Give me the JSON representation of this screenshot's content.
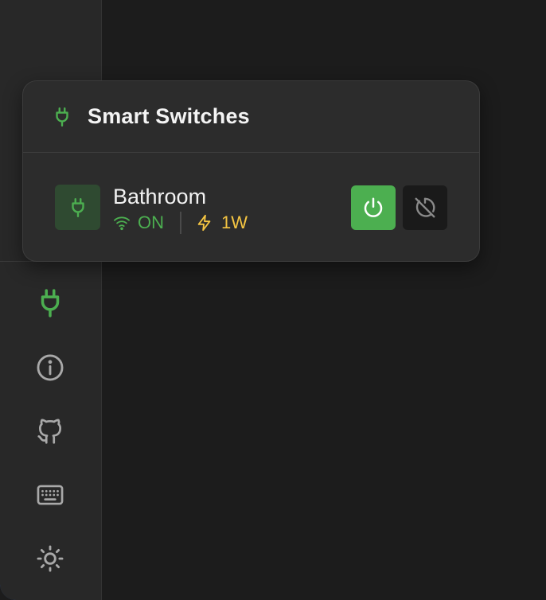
{
  "panel": {
    "title": "Smart Switches",
    "title_icon": "plug-icon"
  },
  "switches": [
    {
      "name": "Bathroom",
      "state": "ON",
      "power": "1W",
      "icons": {
        "device": "plug-icon",
        "signal": "wifi-icon",
        "power": "bolt-icon",
        "toggle": "power-icon",
        "timer": "timer-off-icon"
      }
    }
  ],
  "sidebar": {
    "items": [
      {
        "id": "switches",
        "icon": "plug-icon",
        "active": true
      },
      {
        "id": "info",
        "icon": "info-icon",
        "active": false
      },
      {
        "id": "github",
        "icon": "github-icon",
        "active": false
      },
      {
        "id": "keyboard",
        "icon": "keyboard-icon",
        "active": false
      },
      {
        "id": "theme",
        "icon": "sun-icon",
        "active": false
      }
    ]
  },
  "colors": {
    "accent": "#4caf50",
    "power_text": "#f5c542",
    "background": "#1c1c1c",
    "panel": "#2c2c2c"
  }
}
